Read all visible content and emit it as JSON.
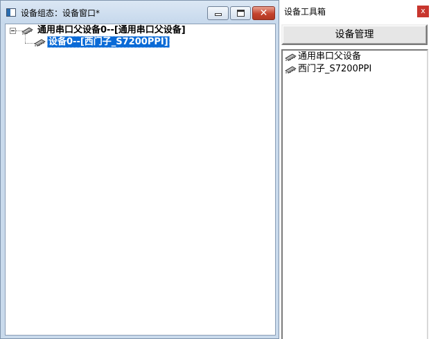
{
  "config_window": {
    "title": "设备组态：设备窗口*",
    "controls": {
      "minimize_icon": "minimize-icon",
      "maximize_icon": "maximize-icon",
      "close_label": "✕"
    },
    "tree": {
      "parent": {
        "icon": "device-chip-icon",
        "label": "通用串口父设备0--[通用串口父设备]",
        "expanded": true
      },
      "child": {
        "icon": "device-chip-icon",
        "label": "设备0--[西门子_S7200PPI]",
        "selected": true
      }
    }
  },
  "toolbox": {
    "title": "设备工具箱",
    "close_label": "x",
    "manage_button_label": "设备管理",
    "items": [
      {
        "icon": "device-chip-icon",
        "label": "通用串口父设备"
      },
      {
        "icon": "device-chip-icon",
        "label": "西门子_S7200PPI"
      }
    ]
  },
  "colors": {
    "window_frame": "#c9daec",
    "selection": "#0a6ad6",
    "close_button": "#c4432d"
  }
}
